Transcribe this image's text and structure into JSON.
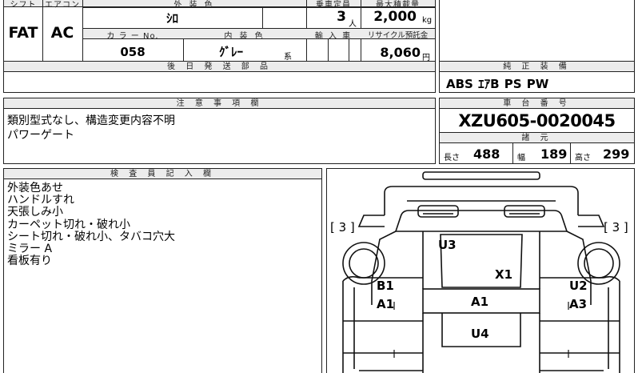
{
  "top": {
    "shift_header": "シフト",
    "aircon_header": "エアコン",
    "ext_color_header": "外 装 色",
    "capacity_header": "乗車定員",
    "load_header": "最大積載量",
    "shift": "FAT",
    "aircon": "AC",
    "ext_color": "ｼﾛ",
    "capacity": "3",
    "capacity_unit": "人",
    "load": "2,000",
    "load_unit": "kg",
    "color_no_header": "カ ラ ー No.",
    "int_color_header": "内 装 色",
    "import_header": "輸 入 車",
    "recycle_header": "リサイクル預託金",
    "color_no": "058",
    "int_color": "ｸﾞﾚｰ",
    "int_color_suffix": "系",
    "recycle": "8,060",
    "recycle_unit": "円"
  },
  "later_parts": {
    "header": "後 日 発 送 部 品",
    "value": ""
  },
  "equipment": {
    "header": "純 正 装 備",
    "value": "ABS ｴｱB PS PW"
  },
  "notes": {
    "header": "注 意 事 項 欄",
    "lines": [
      "類別型式なし、構造変更内容不明",
      "パワーゲート"
    ]
  },
  "chassis": {
    "header": "車 台 番 号",
    "number": "XZU605-0020045",
    "spec_header": "諸 元",
    "length_label": "長さ",
    "length": "488",
    "width_label": "幅",
    "width": "189",
    "height_label": "高さ",
    "height": "299"
  },
  "inspector": {
    "header": "検 査 員 記 入 欄",
    "lines": [
      "外装色あせ",
      "ハンドルすれ",
      "天張しみ小",
      "カーペット切れ・破れ小",
      "シート切れ・破れ小、タバコ穴大",
      "ミラー A",
      "看板有り"
    ]
  },
  "diagram": {
    "left_bracket": "[ 3 ]",
    "right_bracket": "[ 3 ]",
    "labels": {
      "u3": "U3",
      "x1": "X1",
      "b1": "B1",
      "a1_left": "A1",
      "a1_center": "A1",
      "u2": "U2",
      "a3": "A3",
      "u4": "U4"
    }
  }
}
